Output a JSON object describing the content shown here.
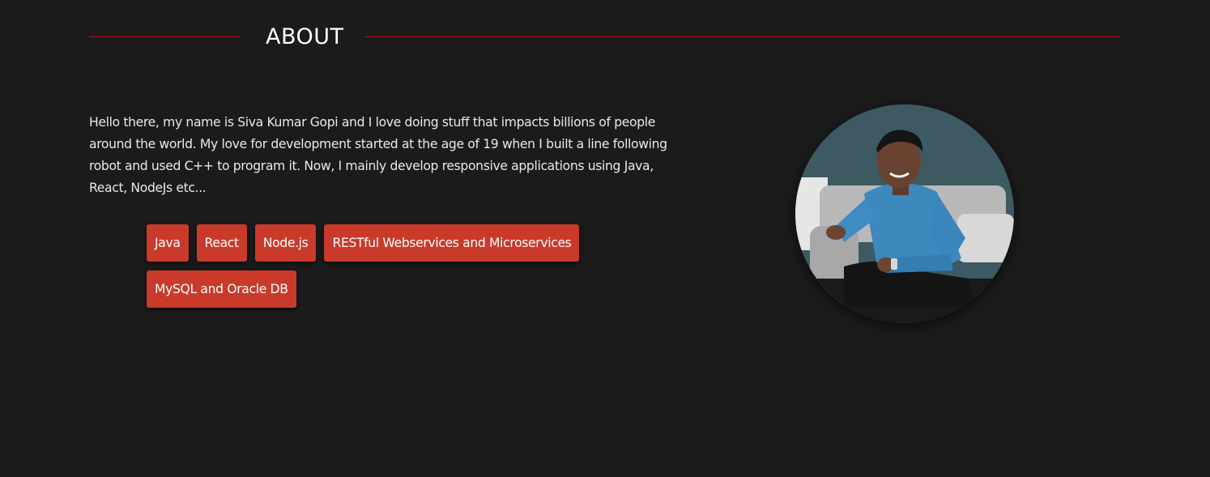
{
  "about": {
    "title": "ABOUT",
    "bio": "Hello there, my name is Siva Kumar Gopi and I love doing stuff that impacts billions of people around the world. My love for development started at the age of 19 when I built a line following robot and used C++ to program it. Now, I mainly develop responsive applications using Java, React, NodeJs etc...",
    "skills": [
      "Java",
      "React",
      "Node.js",
      "RESTful Webservices and Microservices",
      "MySQL and Oracle DB"
    ]
  },
  "colors": {
    "background": "#1b1b1b",
    "accent_line": "#c0121f",
    "skill_badge": "#c93a2b",
    "text": "#ffffff"
  }
}
